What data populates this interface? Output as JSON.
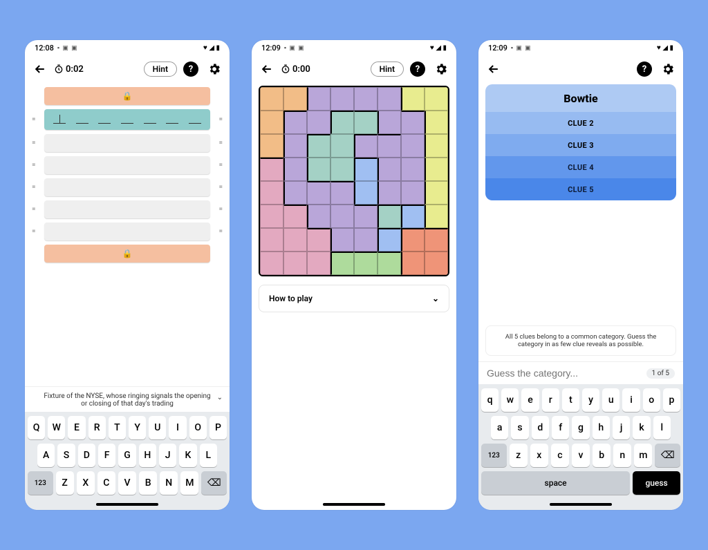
{
  "screen1": {
    "status": {
      "time": "12:08"
    },
    "toolbar": {
      "timer": "0:02",
      "hint_label": "Hint"
    },
    "rows": [
      {
        "type": "locked"
      },
      {
        "type": "active",
        "blanks": 7
      },
      {
        "type": "empty"
      },
      {
        "type": "empty"
      },
      {
        "type": "empty"
      },
      {
        "type": "empty"
      },
      {
        "type": "empty"
      },
      {
        "type": "locked"
      }
    ],
    "clue": "Fixture of the NYSE, whose ringing signals the opening or closing of that day's trading",
    "keyboard": {
      "row1": [
        "Q",
        "W",
        "E",
        "R",
        "T",
        "Y",
        "U",
        "I",
        "O",
        "P"
      ],
      "row2": [
        "A",
        "S",
        "D",
        "F",
        "G",
        "H",
        "J",
        "K",
        "L"
      ],
      "row3_func": "123",
      "row3": [
        "Z",
        "X",
        "C",
        "V",
        "B",
        "N",
        "M"
      ]
    }
  },
  "screen2": {
    "status": {
      "time": "12:09"
    },
    "toolbar": {
      "timer": "0:00",
      "hint_label": "Hint"
    },
    "howto_label": "How to play",
    "grid_colors": [
      [
        "or",
        "or",
        "pu",
        "pu",
        "pu",
        "pu",
        "ye",
        "ye"
      ],
      [
        "or",
        "pu",
        "pu",
        "te",
        "te",
        "pu",
        "pu",
        "ye"
      ],
      [
        "or",
        "pu",
        "te",
        "te",
        "pu",
        "pu",
        "pu",
        "ye"
      ],
      [
        "pk",
        "pu",
        "te",
        "te",
        "bl",
        "pu",
        "pu",
        "ye"
      ],
      [
        "pk",
        "pu",
        "pu",
        "pu",
        "bl",
        "pu",
        "pu",
        "ye"
      ],
      [
        "pk",
        "pk",
        "pu",
        "pu",
        "pu",
        "te",
        "bl",
        "ye"
      ],
      [
        "pk",
        "pk",
        "pk",
        "pu",
        "pu",
        "bl",
        "rd",
        "rd"
      ],
      [
        "pk",
        "pk",
        "pk",
        "gn",
        "gn",
        "gn",
        "rd",
        "rd"
      ]
    ],
    "grid_border_top": [
      [
        0,
        0,
        0,
        0,
        0,
        0,
        0,
        0
      ],
      [
        0,
        1,
        0,
        1,
        1,
        0,
        1,
        0
      ],
      [
        0,
        0,
        1,
        0,
        1,
        1,
        0,
        0
      ],
      [
        1,
        0,
        0,
        0,
        1,
        0,
        0,
        0
      ],
      [
        0,
        0,
        1,
        1,
        0,
        0,
        0,
        0
      ],
      [
        0,
        1,
        0,
        0,
        1,
        1,
        1,
        0
      ],
      [
        0,
        0,
        1,
        0,
        0,
        1,
        1,
        1
      ],
      [
        0,
        0,
        0,
        1,
        1,
        1,
        0,
        0
      ]
    ],
    "grid_border_left": [
      [
        0,
        0,
        1,
        0,
        0,
        0,
        1,
        0
      ],
      [
        0,
        1,
        0,
        1,
        0,
        1,
        0,
        1
      ],
      [
        0,
        1,
        1,
        0,
        1,
        0,
        0,
        1
      ],
      [
        0,
        1,
        1,
        0,
        1,
        1,
        0,
        1
      ],
      [
        0,
        1,
        0,
        0,
        1,
        1,
        0,
        1
      ],
      [
        0,
        0,
        1,
        0,
        0,
        1,
        1,
        1
      ],
      [
        0,
        0,
        0,
        1,
        0,
        1,
        1,
        0
      ],
      [
        0,
        0,
        0,
        1,
        0,
        0,
        1,
        0
      ]
    ]
  },
  "screen3": {
    "status": {
      "time": "12:09"
    },
    "clues": {
      "title": "Bowtie",
      "items": [
        "CLUE 2",
        "CLUE 3",
        "CLUE 4",
        "CLUE 5"
      ]
    },
    "instructions": "All 5 clues belong to a common category. Guess the category in as few clue reveals as possible.",
    "guess_placeholder": "Guess the category...",
    "counter": "1 of 5",
    "keyboard": {
      "row1": [
        "q",
        "w",
        "e",
        "r",
        "t",
        "y",
        "u",
        "i",
        "o",
        "p"
      ],
      "row2": [
        "a",
        "s",
        "d",
        "f",
        "g",
        "h",
        "j",
        "k",
        "l"
      ],
      "row3_func": "123",
      "row3": [
        "z",
        "x",
        "c",
        "v",
        "b",
        "n",
        "m"
      ],
      "space_label": "space",
      "guess_label": "guess"
    }
  }
}
